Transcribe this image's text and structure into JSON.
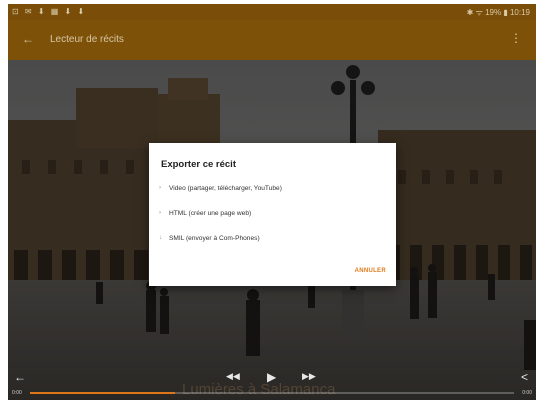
{
  "status_bar": {
    "left_icons": "⊡ ✉ ⬇ ▦ ⬇ ⬇",
    "right_text": "✱ ᯤ 19% ▮ 10:19"
  },
  "app_bar": {
    "title": "Lecteur de récits",
    "back_icon": "←",
    "overflow_icon": "⋮"
  },
  "dialog": {
    "title": "Exporter ce récit",
    "options": [
      {
        "bullet": "›",
        "label": "Video (partager, télécharger, YouTube)"
      },
      {
        "bullet": "›",
        "label": "HTML (créer une page web)"
      },
      {
        "bullet": "↓",
        "label": "SMIL (envoyer à Com-Phones)"
      }
    ],
    "cancel_label": "ANNULER"
  },
  "player": {
    "caption": "Lumières à Salamanca",
    "time_left": "0:00",
    "time_right": "0:00",
    "progress": 0.3,
    "accent_color": "#e0761a"
  },
  "icons": {
    "back": "←",
    "rewind": "◀◀",
    "play": "▶",
    "forward": "▶▶",
    "share": "<"
  }
}
